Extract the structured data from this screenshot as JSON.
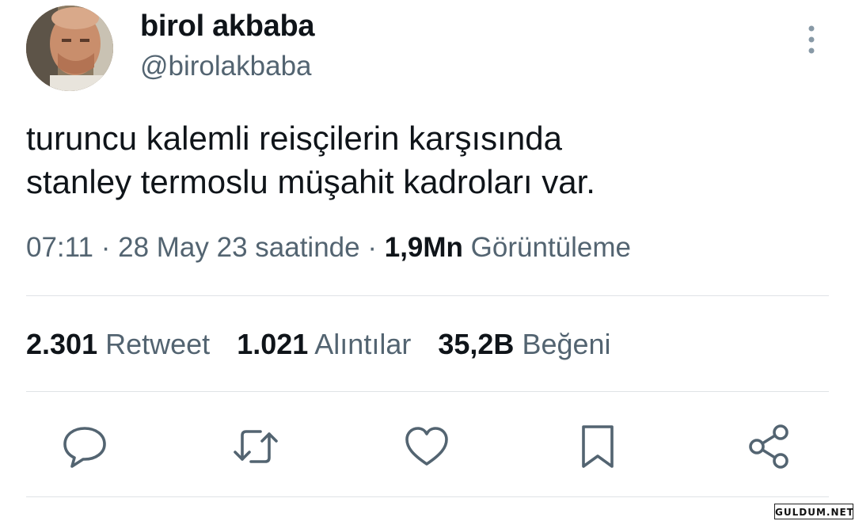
{
  "author": {
    "display_name": "birol akbaba",
    "handle": "@birolakbaba"
  },
  "tweet": {
    "text_lines": [
      "turuncu kalemli reisçilerin karşısında",
      "stanley termoslu müşahit kadroları var."
    ],
    "time": "07:11",
    "date": "28 May 23 saatinde",
    "views_count": "1,9Mn",
    "views_label": "Görüntüleme"
  },
  "stats": {
    "retweets_count": "2.301",
    "retweets_label": "Retweet",
    "quotes_count": "1.021",
    "quotes_label": "Alıntılar",
    "likes_count": "35,2B",
    "likes_label": "Beğeni"
  },
  "actions": [
    "reply-icon",
    "retweet-icon",
    "like-icon",
    "bookmark-icon",
    "share-icon"
  ],
  "watermark": "GULDUM.NET",
  "colors": {
    "text_primary": "#0f1419",
    "text_secondary": "#536471",
    "divider": "#dfe3e6",
    "icon": "#536471"
  }
}
